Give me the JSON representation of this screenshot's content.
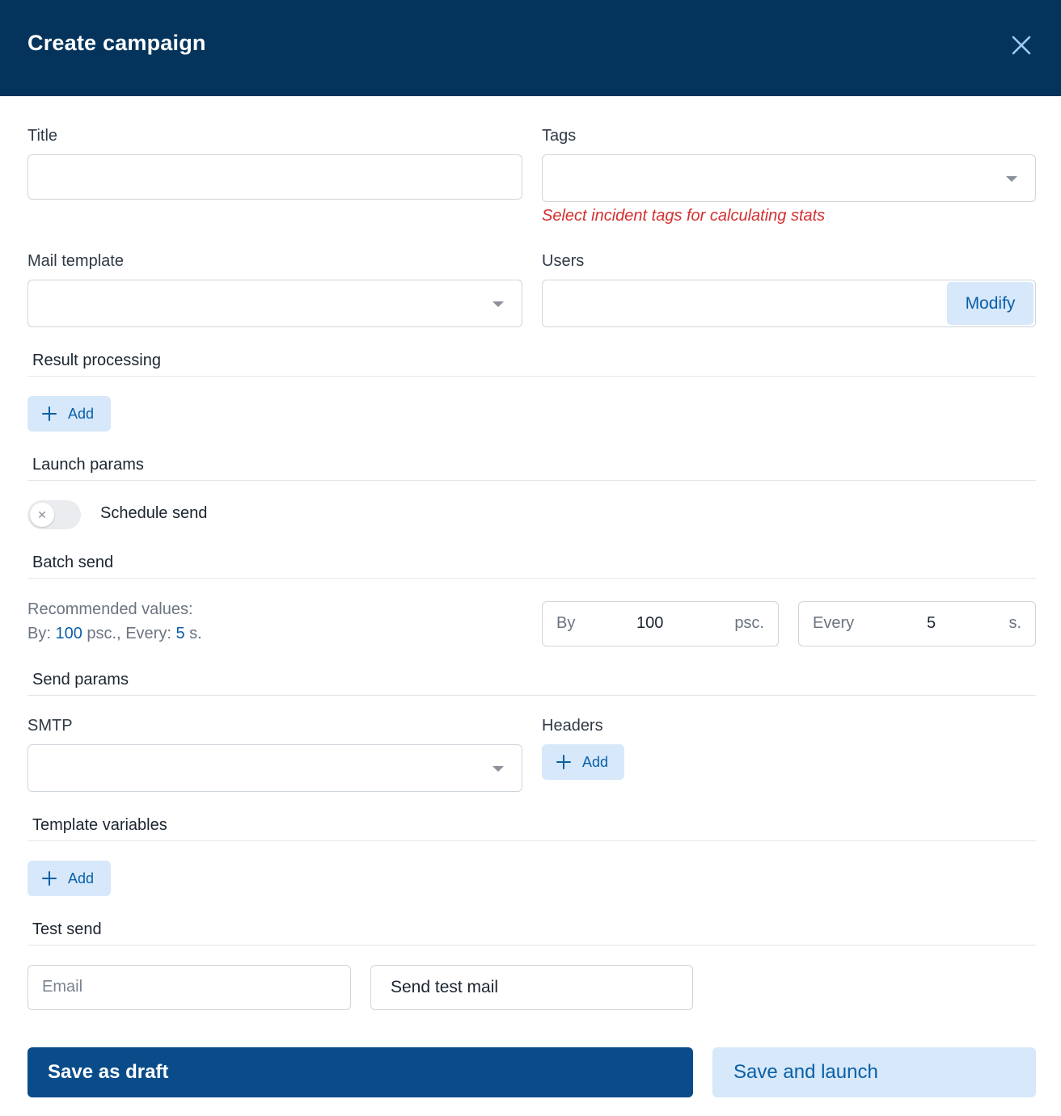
{
  "dialog": {
    "title": "Create campaign"
  },
  "fields": {
    "title": {
      "label": "Title",
      "value": ""
    },
    "tags": {
      "label": "Tags",
      "value": "",
      "hint": "Select incident tags for calculating stats"
    },
    "mail_template": {
      "label": "Mail template",
      "value": ""
    },
    "users": {
      "label": "Users",
      "value": "",
      "modify_label": "Modify"
    }
  },
  "sections": {
    "result_processing": {
      "title": "Result processing",
      "add_label": "Add"
    },
    "launch_params": {
      "title": "Launch params",
      "schedule_send_label": "Schedule send",
      "schedule_send_enabled": false
    },
    "batch_send": {
      "title": "Batch send",
      "recommended_title": "Recommended values:",
      "rec_by_prefix": "By:",
      "rec_by_value": "100",
      "rec_by_suffix": "psc., Every:",
      "rec_every_value": "5",
      "rec_every_suffix": "s.",
      "by_label": "By",
      "by_value": "100",
      "by_unit": "psc.",
      "every_label": "Every",
      "every_value": "5",
      "every_unit": "s."
    },
    "send_params": {
      "title": "Send params",
      "smtp_label": "SMTP",
      "smtp_value": "",
      "headers_label": "Headers",
      "headers_add_label": "Add"
    },
    "template_variables": {
      "title": "Template variables",
      "add_label": "Add"
    },
    "test_send": {
      "title": "Test send",
      "email_placeholder": "Email",
      "send_test_label": "Send test mail"
    }
  },
  "footer": {
    "save_draft_label": "Save as draft",
    "save_launch_label": "Save and launch"
  },
  "colors": {
    "header_bg": "#04345b",
    "primary": "#0a4c8a",
    "accent_light": "#d6e8fa",
    "accent_text": "#0b5fa5",
    "error": "#d32f2f"
  },
  "icons": {
    "close": "close-icon",
    "dropdown": "chevron-down-icon",
    "add": "plus-icon",
    "toggle_off": "x-icon"
  }
}
